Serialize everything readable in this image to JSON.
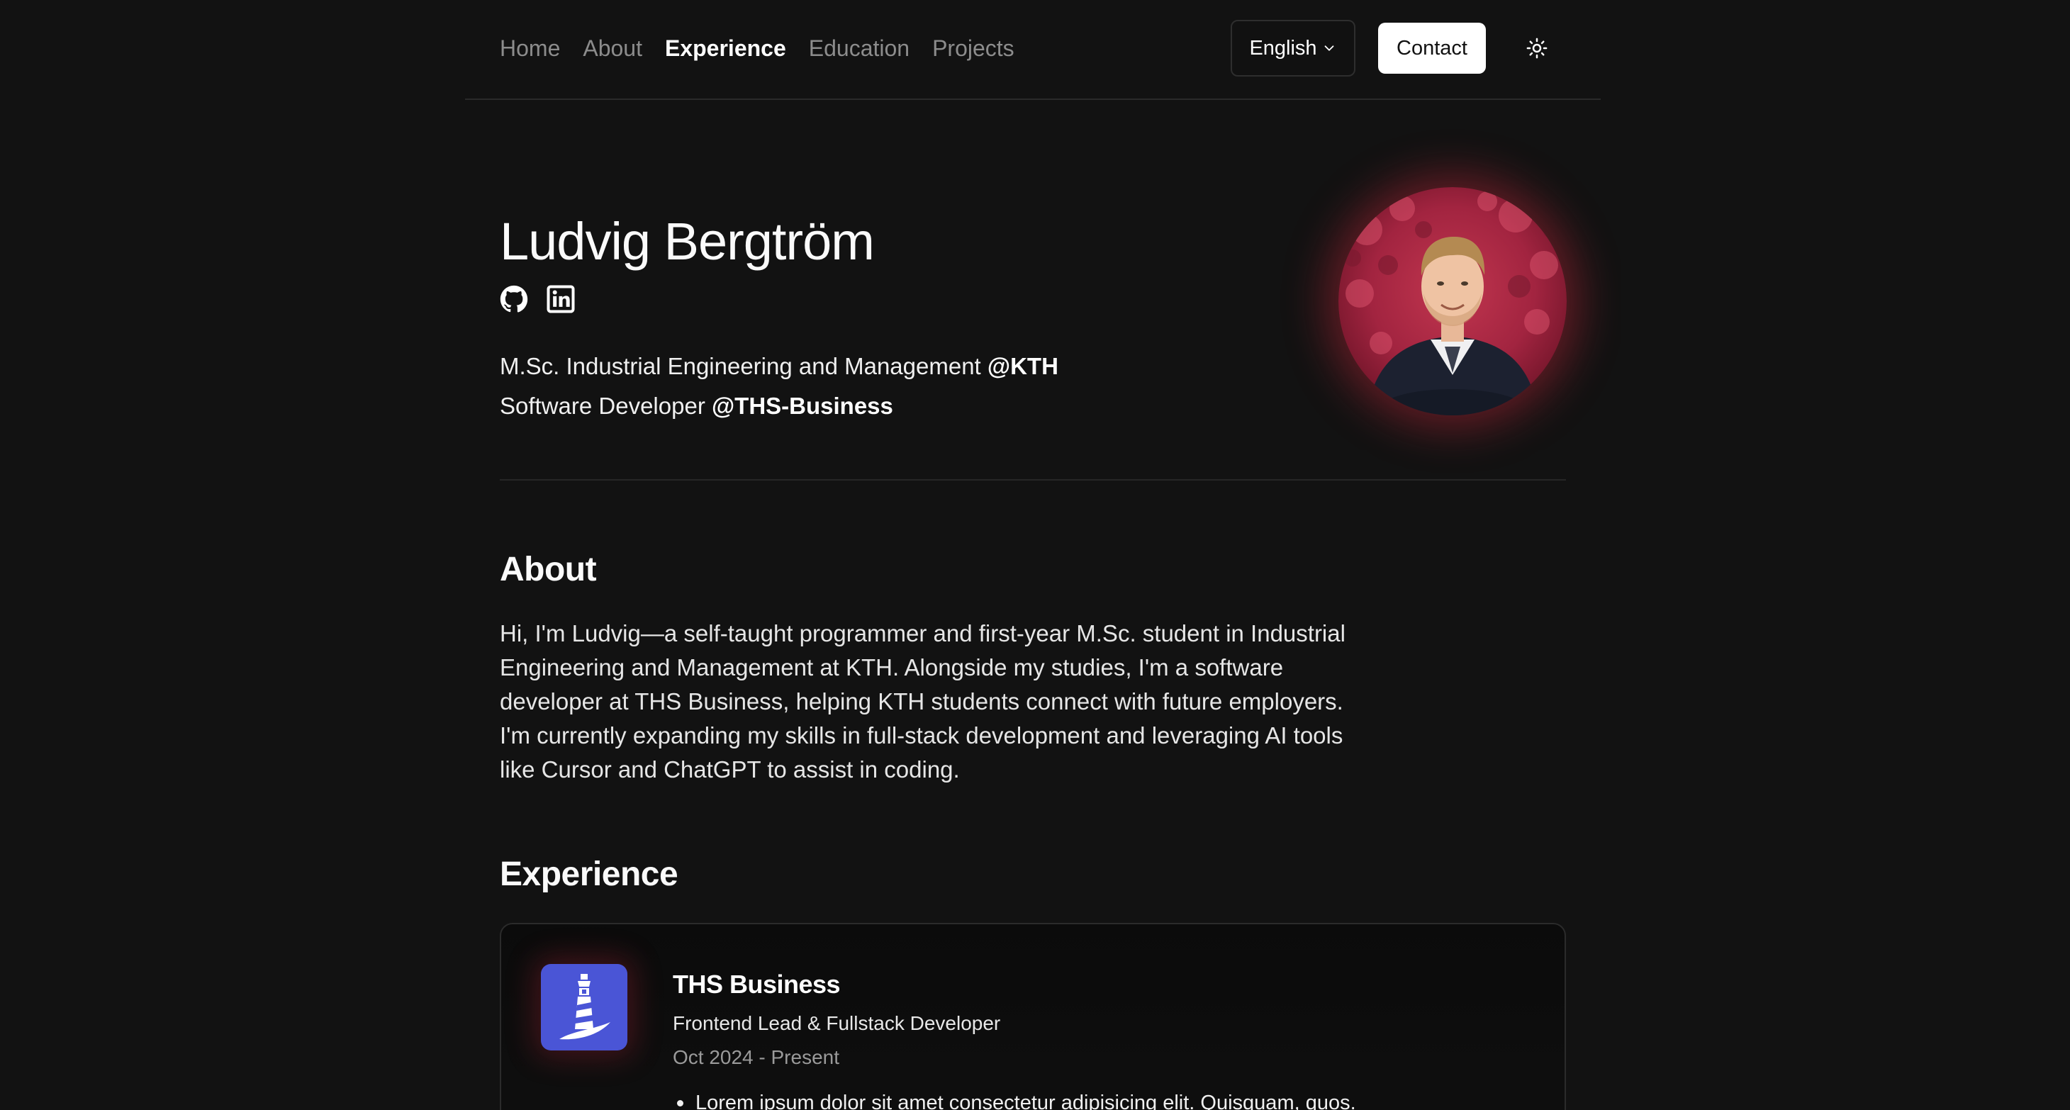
{
  "nav": {
    "links": [
      {
        "label": "Home",
        "active": false
      },
      {
        "label": "About",
        "active": false
      },
      {
        "label": "Experience",
        "active": true
      },
      {
        "label": "Education",
        "active": false
      },
      {
        "label": "Projects",
        "active": false
      }
    ],
    "language": "English",
    "contact_label": "Contact",
    "theme_icon": "sun-icon"
  },
  "hero": {
    "name": "Ludvig Bergtröm",
    "socials": [
      {
        "icon": "github-icon"
      },
      {
        "icon": "linkedin-icon"
      }
    ],
    "line1_prefix": "M.Sc. Industrial Engineering and Management ",
    "line1_org": "@KTH",
    "line2_prefix": "Software Developer ",
    "line2_org": "@THS-Business"
  },
  "about": {
    "title": "About",
    "text": "Hi, I'm Ludvig—a self-taught programmer and first-year M.Sc. student in Industrial Engineering and Management at KTH. Alongside my studies, I'm a software developer at THS Business, helping KTH students connect with future employers. I'm currently expanding my skills in full-stack development and leveraging AI tools like Cursor and ChatGPT to assist in coding."
  },
  "experience": {
    "title": "Experience",
    "items": [
      {
        "company": "THS Business",
        "role": "Frontend Lead & Fullstack Developer",
        "dates": "Oct 2024 - Present",
        "logo_color": "#4a55d6",
        "logo_icon": "lighthouse-icon",
        "bullets": [
          "Lorem ipsum dolor sit amet consectetur adipisicing elit. Quisquam, quos."
        ]
      }
    ]
  },
  "colors": {
    "background": "#121212",
    "text": "#f2f2f2",
    "muted": "#8c8c8c",
    "avatar_glow": "#c8283c",
    "logo_bg": "#4a55d6"
  }
}
